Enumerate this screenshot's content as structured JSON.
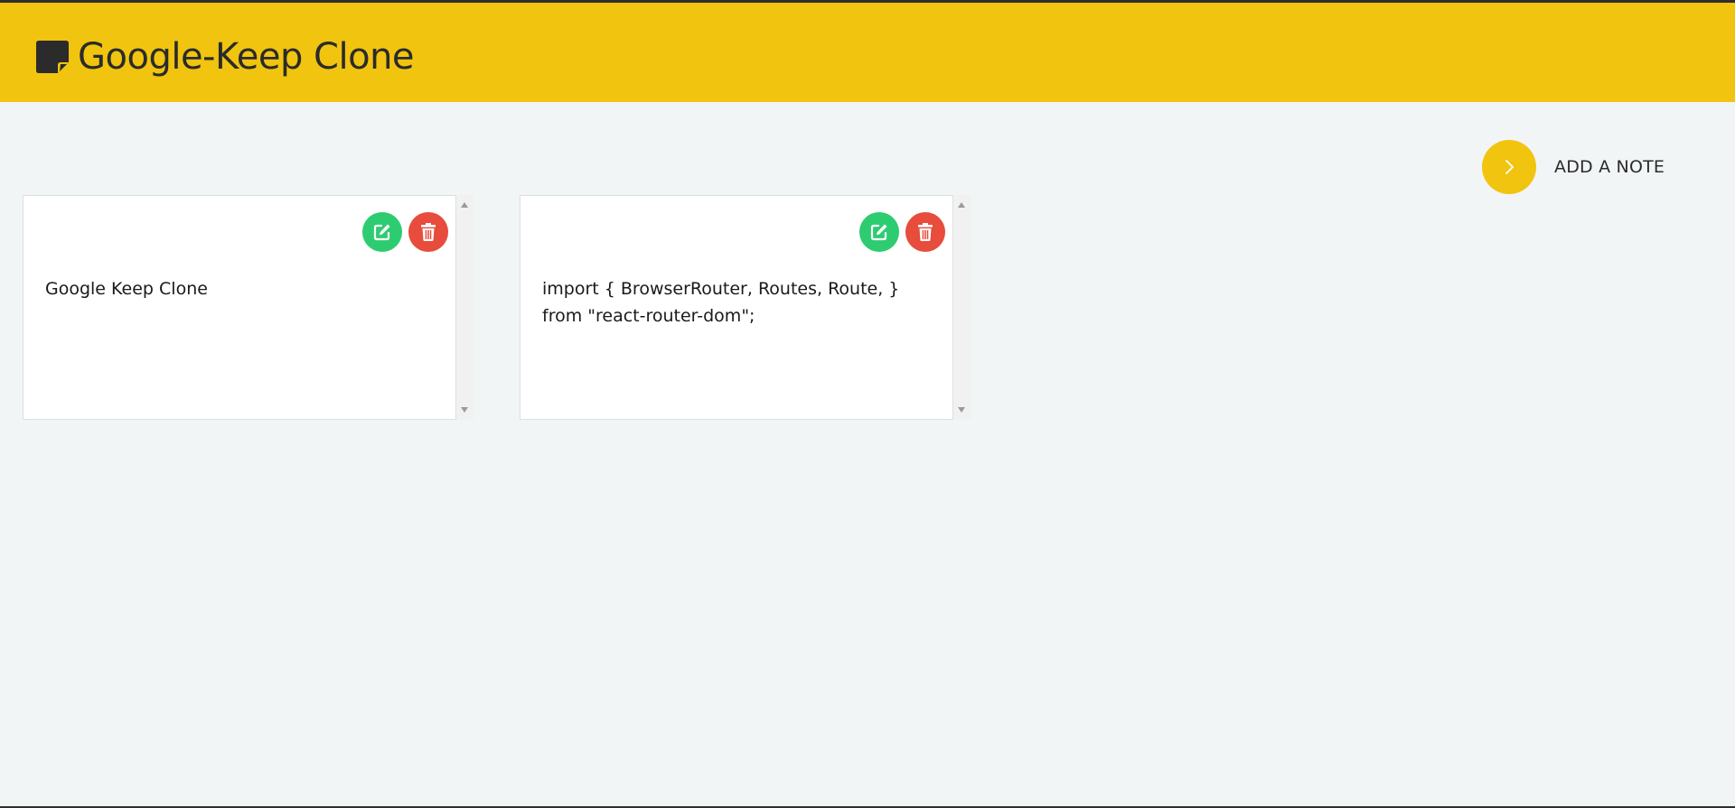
{
  "header": {
    "title": "Google-Keep Clone",
    "icon": "sticky-note-icon",
    "background": "#f1c40f"
  },
  "actions": {
    "add_note_label": "ADD A NOTE",
    "add_note_icon": "chevron-right-icon"
  },
  "notes": [
    {
      "text": "Google Keep Clone",
      "edit_icon": "edit-icon",
      "delete_icon": "trash-icon"
    },
    {
      "text": "import { BrowserRouter, Routes, Route, }\nfrom \"react-router-dom\";",
      "edit_icon": "edit-icon",
      "delete_icon": "trash-icon"
    }
  ],
  "colors": {
    "accent": "#f1c40f",
    "edit": "#2ecc71",
    "delete": "#e74c3c",
    "page_background": "#f2f5f6"
  }
}
